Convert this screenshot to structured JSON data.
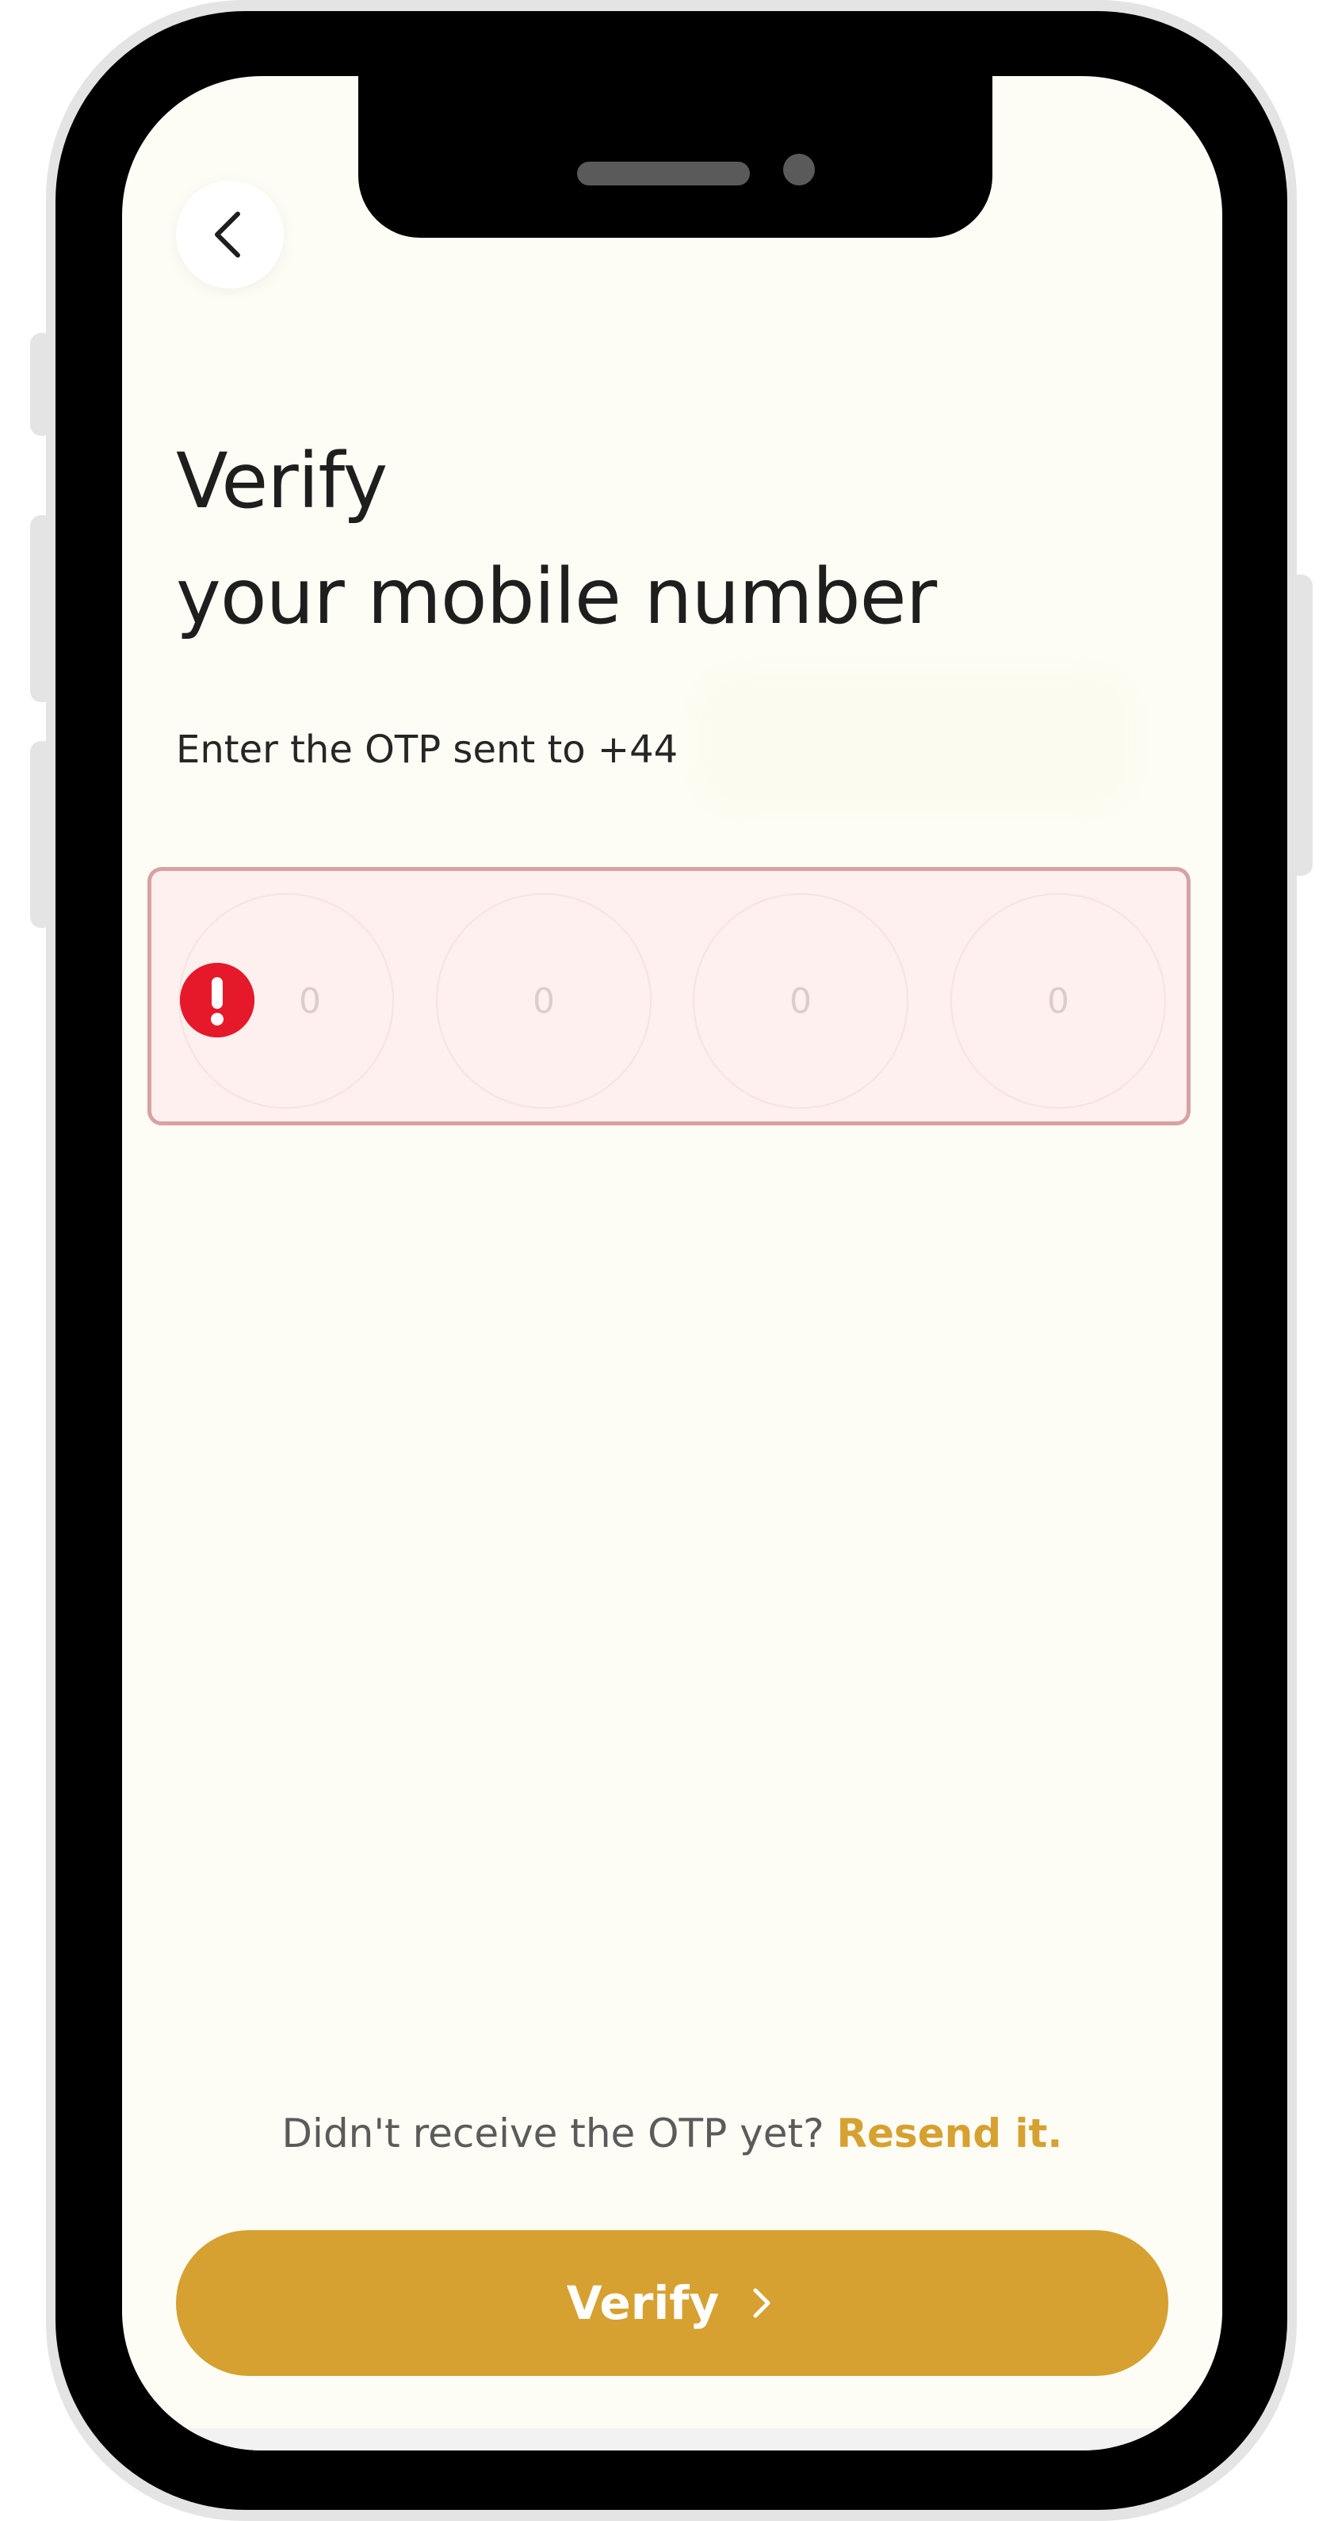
{
  "screen": {
    "title_line1": "Verify",
    "title_line2": "your mobile number",
    "subtitle": "Enter the OTP sent to +44"
  },
  "otp": {
    "state": "error",
    "cells": [
      "0",
      "0",
      "0",
      "0"
    ]
  },
  "resend": {
    "prompt": "Didn't receive the OTP yet?",
    "link_label": "Resend it."
  },
  "verify_button": {
    "label": "Verify"
  },
  "icons": {
    "back": "chevron-left-icon",
    "error": "exclamation-icon",
    "verify": "chevron-right-icon",
    "nav_recents": "recents-icon",
    "nav_home": "home-icon",
    "nav_back": "back-icon"
  },
  "colors": {
    "accent": "#d6a131",
    "error": "#e5192a",
    "error_border": "#d8a2a2",
    "error_fill": "#fdf0ef",
    "background": "#fdfdf5"
  }
}
